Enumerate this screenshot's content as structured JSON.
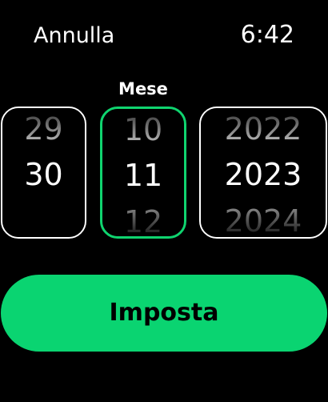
{
  "header": {
    "cancel_label": "Annulla",
    "time": "6:42"
  },
  "picker": {
    "active_label": "Mese",
    "day": {
      "prev": "29",
      "current": "30",
      "next": ""
    },
    "month": {
      "prev": "10",
      "current": "11",
      "next": "12"
    },
    "year": {
      "prev": "2022",
      "current": "2023",
      "next": "2024"
    }
  },
  "actions": {
    "set_label": "Imposta"
  },
  "colors": {
    "background": "#000000",
    "accent": "#0ad471",
    "active_border": "#0fd46f",
    "text": "#ffffff"
  }
}
